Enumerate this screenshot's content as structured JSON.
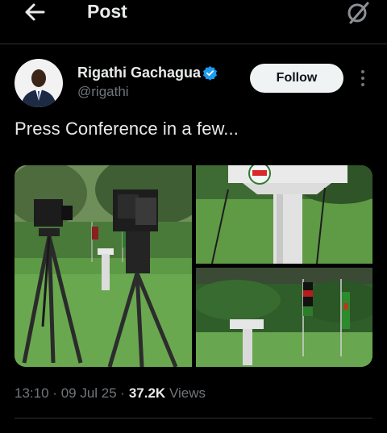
{
  "header": {
    "title": "Post",
    "back_icon": "arrow-left-icon",
    "grok_icon": "grok-icon"
  },
  "author": {
    "display_name": "Rigathi Gachagua",
    "handle": "@rigathi",
    "verified": true,
    "verified_color": "#1d9bf0"
  },
  "follow_label": "Follow",
  "more_icon": "more-vertical-icon",
  "post": {
    "text": "Press Conference in a few...",
    "media": [
      {
        "description": "Two TV cameras on tripods on a lawn facing a podium"
      },
      {
        "description": "Close-up of a white podium with DCP logo"
      },
      {
        "description": "Podium on a lawn with Kenyan flags and green hedge"
      }
    ]
  },
  "meta": {
    "time": "13:10",
    "sep1": "·",
    "date": "09 Jul 25",
    "sep2": "·",
    "views_count": "37.2K",
    "views_label": "Views"
  },
  "colors": {
    "background": "#000000",
    "text_primary": "#e7e9ea",
    "text_secondary": "#71767b",
    "divider": "#2f3336",
    "follow_bg": "#eff3f4"
  }
}
